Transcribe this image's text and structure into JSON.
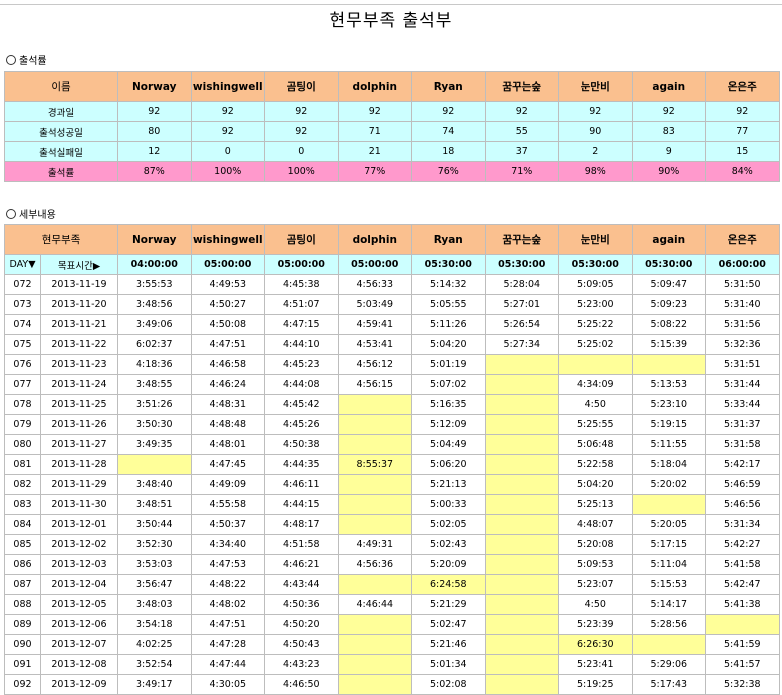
{
  "title": "현무부족 출석부",
  "sections": {
    "summary": "출석률",
    "detail": "세부내용"
  },
  "names": [
    "Norway",
    "wishingwell",
    "곰팅이",
    "dolphin",
    "Ryan",
    "꿈꾸는숲",
    "눈만비",
    "again",
    "온은주"
  ],
  "summary": {
    "header_label": "이름",
    "rows": [
      {
        "label": "경과일",
        "values": [
          "92",
          "92",
          "92",
          "92",
          "92",
          "92",
          "92",
          "92",
          "92"
        ]
      },
      {
        "label": "출석성공일",
        "values": [
          "80",
          "92",
          "92",
          "71",
          "74",
          "55",
          "90",
          "83",
          "77"
        ]
      },
      {
        "label": "출석실패일",
        "values": [
          "12",
          "0",
          "0",
          "21",
          "18",
          "37",
          "2",
          "9",
          "15"
        ]
      }
    ],
    "rate": {
      "label": "출석률",
      "values": [
        "87%",
        "100%",
        "100%",
        "77%",
        "76%",
        "71%",
        "98%",
        "90%",
        "84%"
      ]
    }
  },
  "detail": {
    "header_label": "현무부족",
    "day_label": "DAY▼",
    "target_label": "목표시간▶",
    "targets": [
      "04:00:00",
      "05:00:00",
      "05:00:00",
      "05:00:00",
      "05:30:00",
      "05:30:00",
      "05:30:00",
      "05:30:00",
      "06:00:00"
    ],
    "rows": [
      {
        "day": "072",
        "date": "2013-11-19",
        "times": [
          "3:55:53",
          "4:49:53",
          "4:45:38",
          "4:56:33",
          "5:14:32",
          "5:28:04",
          "5:09:05",
          "5:09:47",
          "5:31:50"
        ]
      },
      {
        "day": "073",
        "date": "2013-11-20",
        "times": [
          "3:48:56",
          "4:50:27",
          "4:51:07",
          "5:03:49",
          "5:05:55",
          "5:27:01",
          "5:23:00",
          "5:09:23",
          "5:31:40"
        ]
      },
      {
        "day": "074",
        "date": "2013-11-21",
        "times": [
          "3:49:06",
          "4:50:08",
          "4:47:15",
          "4:59:41",
          "5:11:26",
          "5:26:54",
          "5:25:22",
          "5:08:22",
          "5:31:56"
        ]
      },
      {
        "day": "075",
        "date": "2013-11-22",
        "times": [
          "6:02:37",
          "4:47:51",
          "4:44:10",
          "4:53:41",
          "5:04:20",
          "5:27:34",
          "5:25:02",
          "5:15:39",
          "5:32:36"
        ]
      },
      {
        "day": "076",
        "date": "2013-11-23",
        "times": [
          "4:18:36",
          "4:46:58",
          "4:45:23",
          "4:56:12",
          "5:01:19",
          "",
          "",
          "",
          "5:31:51"
        ]
      },
      {
        "day": "077",
        "date": "2013-11-24",
        "times": [
          "3:48:55",
          "4:46:24",
          "4:44:08",
          "4:56:15",
          "5:07:02",
          "",
          "4:34:09",
          "5:13:53",
          "5:31:44"
        ]
      },
      {
        "day": "078",
        "date": "2013-11-25",
        "times": [
          "3:51:26",
          "4:48:31",
          "4:45:42",
          "",
          "5:16:35",
          "",
          "4:50",
          "5:23:10",
          "5:33:44"
        ]
      },
      {
        "day": "079",
        "date": "2013-11-26",
        "times": [
          "3:50:30",
          "4:48:48",
          "4:45:26",
          "",
          "5:12:09",
          "",
          "5:25:55",
          "5:19:15",
          "5:31:37"
        ]
      },
      {
        "day": "080",
        "date": "2013-11-27",
        "times": [
          "3:49:35",
          "4:48:01",
          "4:50:38",
          "",
          "5:04:49",
          "",
          "5:06:48",
          "5:11:55",
          "5:31:58"
        ]
      },
      {
        "day": "081",
        "date": "2013-11-28",
        "times": [
          "",
          "4:47:45",
          "4:44:35",
          "8:55:37",
          "5:06:20",
          "",
          "5:22:58",
          "5:18:04",
          "5:42:17"
        ]
      },
      {
        "day": "082",
        "date": "2013-11-29",
        "times": [
          "3:48:40",
          "4:49:09",
          "4:46:11",
          "",
          "5:21:13",
          "",
          "5:04:20",
          "5:20:02",
          "5:46:59"
        ]
      },
      {
        "day": "083",
        "date": "2013-11-30",
        "times": [
          "3:48:51",
          "4:55:58",
          "4:44:15",
          "",
          "5:00:33",
          "",
          "5:25:13",
          "",
          "5:46:56"
        ]
      },
      {
        "day": "084",
        "date": "2013-12-01",
        "times": [
          "3:50:44",
          "4:50:37",
          "4:48:17",
          "",
          "5:02:05",
          "",
          "4:48:07",
          "5:20:05",
          "5:31:34"
        ]
      },
      {
        "day": "085",
        "date": "2013-12-02",
        "times": [
          "3:52:30",
          "4:34:40",
          "4:51:58",
          "4:49:31",
          "5:02:43",
          "",
          "5:20:08",
          "5:17:15",
          "5:42:27"
        ]
      },
      {
        "day": "086",
        "date": "2013-12-03",
        "times": [
          "3:53:03",
          "4:47:53",
          "4:46:21",
          "4:56:36",
          "5:20:09",
          "",
          "5:09:53",
          "5:11:04",
          "5:41:58"
        ]
      },
      {
        "day": "087",
        "date": "2013-12-04",
        "times": [
          "3:56:47",
          "4:48:22",
          "4:43:44",
          "",
          "6:24:58",
          "",
          "5:23:07",
          "5:15:53",
          "5:42:47"
        ]
      },
      {
        "day": "088",
        "date": "2013-12-05",
        "times": [
          "3:48:03",
          "4:48:02",
          "4:50:36",
          "4:46:44",
          "5:21:29",
          "",
          "4:50",
          "5:14:17",
          "5:41:38"
        ]
      },
      {
        "day": "089",
        "date": "2013-12-06",
        "times": [
          "3:54:18",
          "4:47:51",
          "4:50:20",
          "",
          "5:02:47",
          "",
          "5:23:39",
          "5:28:56",
          ""
        ]
      },
      {
        "day": "090",
        "date": "2013-12-07",
        "times": [
          "4:02:25",
          "4:47:28",
          "4:50:43",
          "",
          "5:21:46",
          "",
          "6:26:30",
          "",
          "5:41:59"
        ]
      },
      {
        "day": "091",
        "date": "2013-12-08",
        "times": [
          "3:52:54",
          "4:47:44",
          "4:43:23",
          "",
          "5:01:34",
          "",
          "5:23:41",
          "5:29:06",
          "5:41:57"
        ]
      },
      {
        "day": "092",
        "date": "2013-12-09",
        "times": [
          "3:49:17",
          "4:30:05",
          "4:46:50",
          "",
          "5:02:08",
          "",
          "5:19:25",
          "5:17:43",
          "5:32:38"
        ]
      }
    ],
    "missed_marks": [
      [
        "072",
        []
      ],
      [
        "073",
        []
      ],
      [
        "074",
        []
      ],
      [
        "075",
        []
      ],
      [
        "076",
        [
          5,
          6,
          7
        ]
      ],
      [
        "077",
        [
          5
        ]
      ],
      [
        "078",
        [
          3,
          5
        ]
      ],
      [
        "079",
        [
          3,
          5
        ]
      ],
      [
        "080",
        [
          3,
          5
        ]
      ],
      [
        "081",
        [
          0,
          3,
          5
        ]
      ],
      [
        "082",
        [
          3,
          5
        ]
      ],
      [
        "083",
        [
          3,
          5,
          7
        ]
      ],
      [
        "084",
        [
          3,
          5
        ]
      ],
      [
        "085",
        [
          5
        ]
      ],
      [
        "086",
        [
          5
        ]
      ],
      [
        "087",
        [
          3,
          4,
          5
        ]
      ],
      [
        "088",
        [
          5
        ]
      ],
      [
        "089",
        [
          3,
          5,
          8
        ]
      ],
      [
        "090",
        [
          3,
          5,
          6,
          7
        ]
      ],
      [
        "091",
        [
          3,
          5
        ]
      ],
      [
        "092",
        [
          3,
          5
        ]
      ]
    ]
  },
  "colors": {
    "header": "#fac08f",
    "cyan": "#ccffff",
    "rate": "#ff99cc",
    "missed": "#ffff99"
  }
}
